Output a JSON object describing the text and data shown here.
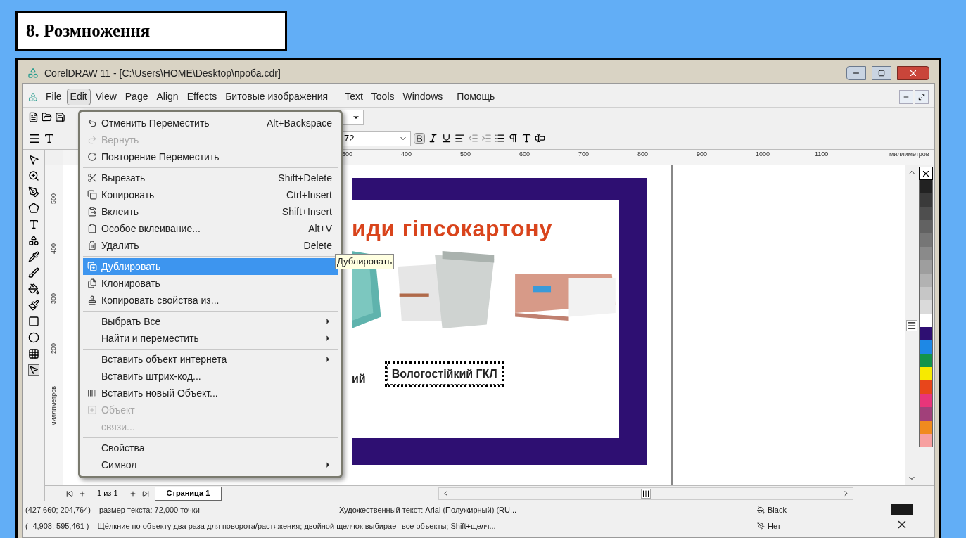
{
  "slide_title": "8. Розмноження",
  "window": {
    "title": "CorelDRAW 11 - [C:\\Users\\HOME\\Desktop\\проба.cdr]"
  },
  "menu_bar": [
    {
      "label": "File",
      "selected": false
    },
    {
      "label": "Edit",
      "selected": true
    },
    {
      "label": "View",
      "selected": false
    },
    {
      "label": "Page",
      "selected": false
    },
    {
      "label": "Align",
      "selected": false
    },
    {
      "label": "Effects",
      "selected": false
    },
    {
      "label": "Битовые изображения",
      "selected": false
    },
    {
      "label": "Text",
      "selected": false
    },
    {
      "label": "Tools",
      "selected": false
    },
    {
      "label": "Windows",
      "selected": false
    },
    {
      "label": "Помощь",
      "selected": false
    }
  ],
  "text_toolbar": {
    "font_size": "72"
  },
  "edit_menu": [
    {
      "kind": "item",
      "label": "Отменить Переместить",
      "shortcut": "Alt+Backspace",
      "disabled": false,
      "selected": false,
      "submenu": false
    },
    {
      "kind": "item",
      "label": "Вернуть",
      "disabled": true,
      "selected": false,
      "submenu": false
    },
    {
      "kind": "item",
      "label": "Повторение Переместить",
      "disabled": false,
      "selected": false,
      "submenu": false
    },
    {
      "kind": "separator"
    },
    {
      "kind": "item",
      "label": "Вырезать",
      "shortcut": "Shift+Delete",
      "disabled": false,
      "selected": false,
      "submenu": false
    },
    {
      "kind": "item",
      "label": "Копировать",
      "shortcut": "Ctrl+Insert",
      "disabled": false,
      "selected": false,
      "submenu": false
    },
    {
      "kind": "item",
      "label": "Вклеить",
      "shortcut": "Shift+Insert",
      "disabled": false,
      "selected": false,
      "submenu": false
    },
    {
      "kind": "item",
      "label": "Особое вклеивание...",
      "shortcut": "Alt+V",
      "disabled": false,
      "selected": false,
      "submenu": false
    },
    {
      "kind": "item",
      "label": "Удалить",
      "shortcut": "Delete",
      "disabled": false,
      "selected": false,
      "submenu": false
    },
    {
      "kind": "separator"
    },
    {
      "kind": "item",
      "label": "Дублировать",
      "disabled": false,
      "selected": true,
      "submenu": false
    },
    {
      "kind": "item",
      "label": "Клонировать",
      "disabled": false,
      "selected": false,
      "submenu": false
    },
    {
      "kind": "item",
      "label": "Копировать свойства из...",
      "disabled": false,
      "selected": false,
      "submenu": false
    },
    {
      "kind": "separator"
    },
    {
      "kind": "item",
      "label": "Выбрать Все",
      "disabled": false,
      "selected": false,
      "submenu": true
    },
    {
      "kind": "item",
      "label": "Найти и переместить",
      "disabled": false,
      "selected": false,
      "submenu": true
    },
    {
      "kind": "separator"
    },
    {
      "kind": "item",
      "label": "Вставить объект интернета",
      "disabled": false,
      "selected": false,
      "submenu": true
    },
    {
      "kind": "item",
      "label": "Вставить штрих-код...",
      "disabled": false,
      "selected": false,
      "submenu": false
    },
    {
      "kind": "item",
      "label": "Вставить новый Объект...",
      "disabled": false,
      "selected": false,
      "submenu": false
    },
    {
      "kind": "item",
      "label": "Объект",
      "disabled": true,
      "selected": false,
      "submenu": false
    },
    {
      "kind": "item",
      "label": "связи...",
      "disabled": true,
      "selected": false,
      "submenu": false
    },
    {
      "kind": "separator"
    },
    {
      "kind": "item",
      "label": "Свойства",
      "disabled": false,
      "selected": false,
      "submenu": false
    },
    {
      "kind": "item",
      "label": "Символ",
      "disabled": false,
      "selected": false,
      "submenu": true
    }
  ],
  "tooltip": "Дублировать",
  "top_ruler": {
    "labels": [
      "300",
      "400",
      "500",
      "600",
      "700",
      "800",
      "900",
      "1000",
      "1100"
    ],
    "unit": "миллиметров"
  },
  "left_ruler": {
    "labels": [
      "500",
      "400",
      "300",
      "200"
    ],
    "unit": "миллиметров"
  },
  "page": {
    "title": "иди гіпсокартону",
    "captions": [
      {
        "text": "ий",
        "selected": false
      },
      {
        "text": "Вологостійкий ГКЛ",
        "selected": true
      }
    ]
  },
  "palette": [
    {
      "kind": "none"
    },
    {
      "color": "#222222"
    },
    {
      "color": "#3a3a3a"
    },
    {
      "color": "#4e4e4e"
    },
    {
      "color": "#626262"
    },
    {
      "color": "#767676"
    },
    {
      "color": "#8a8a8a"
    },
    {
      "color": "#9e9e9e"
    },
    {
      "color": "#b2b2b2"
    },
    {
      "color": "#c6c6c6"
    },
    {
      "color": "#dadada"
    },
    {
      "color": "#ffffff"
    },
    {
      "color": "#2e0f72"
    },
    {
      "color": "#1e88e5"
    },
    {
      "color": "#13944a"
    },
    {
      "color": "#f7ea00"
    },
    {
      "color": "#e8461b"
    },
    {
      "color": "#e8357a"
    },
    {
      "color": "#a1407a"
    },
    {
      "color": "#f08a1e"
    },
    {
      "color": "#f7a0a0"
    }
  ],
  "page_nav": {
    "count": "1 из 1",
    "tabs": [
      {
        "label": "Страница 1",
        "selected": true
      }
    ]
  },
  "status_bar": {
    "coords_1": "(427,660; 204,764)",
    "info_1": "размер текста: 72,000 точки",
    "object": "Художественный текст: Arial (Полужирный) (RU...",
    "fill": "Black",
    "coords_2": "( -4,908; 595,461 )",
    "info_2": "Щёлкние по объекту два раза для поворота/растяжения; двойной щелчок выбирает все объекты; Shift+щелч...",
    "outline": "Нет"
  }
}
